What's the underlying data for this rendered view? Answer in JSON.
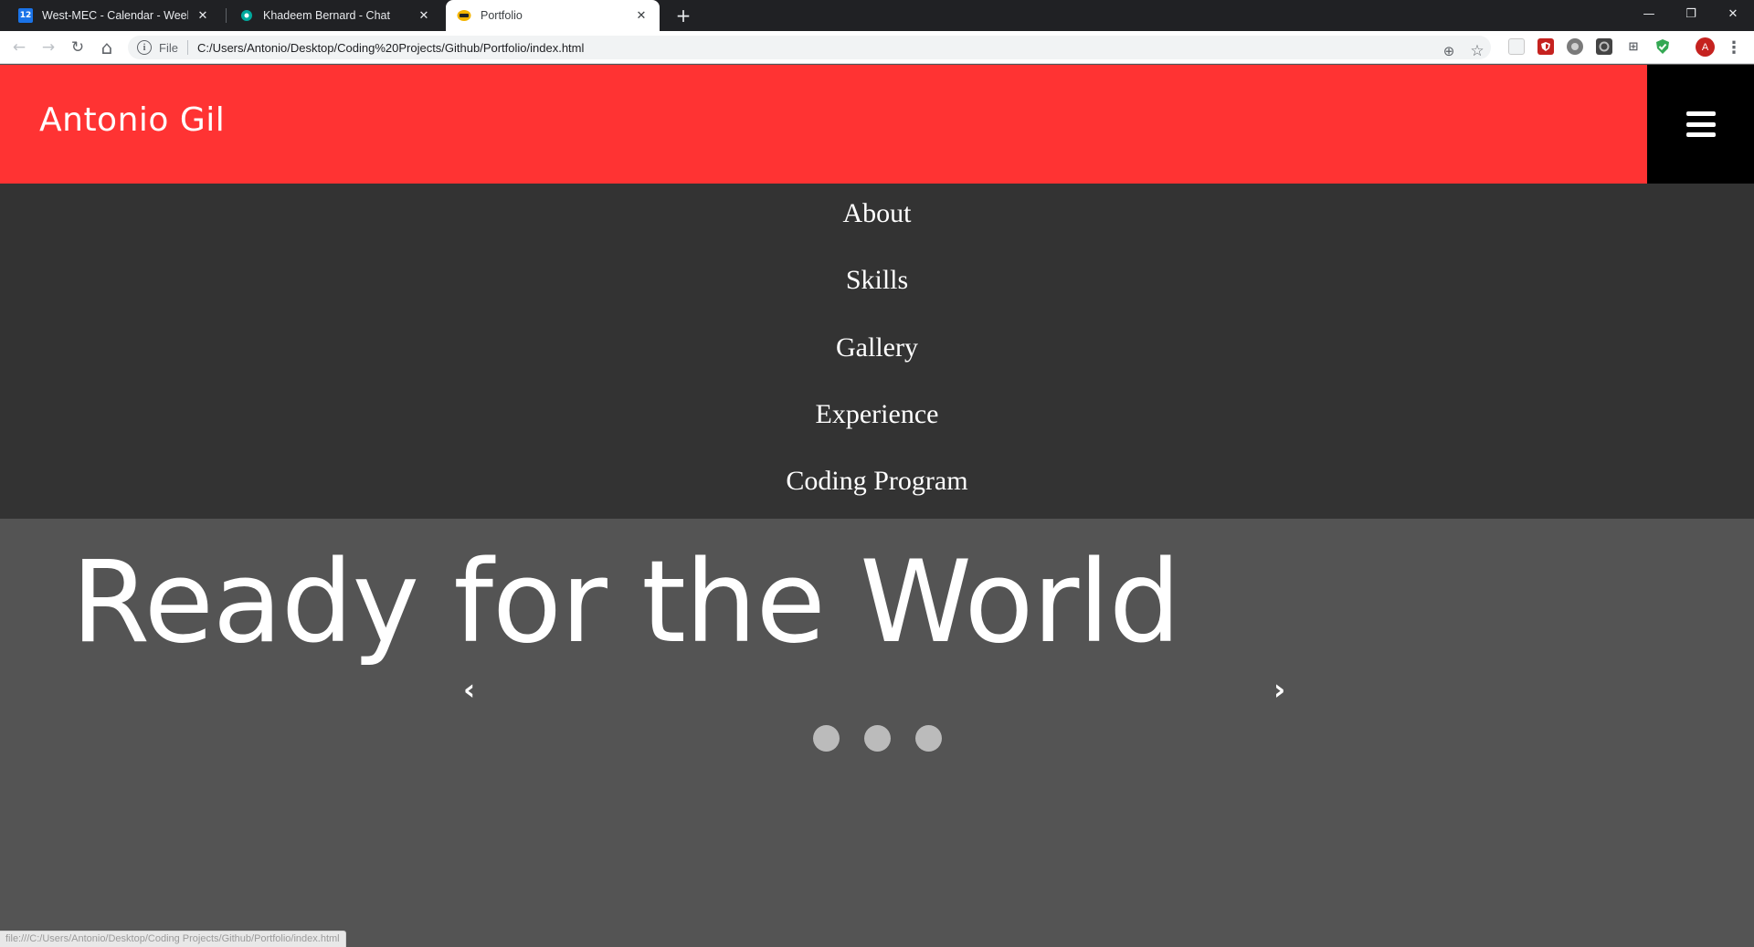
{
  "browser": {
    "tabs": [
      {
        "title": "West-MEC - Calendar - Week of",
        "favicon": "calendar-icon",
        "favicon_text": "12",
        "active": false
      },
      {
        "title": "Khadeem Bernard - Chat",
        "favicon": "chat-icon",
        "favicon_text": "",
        "active": false
      },
      {
        "title": "Portfolio",
        "favicon": "portfolio-icon",
        "favicon_text": "",
        "active": true
      }
    ],
    "new_tab_label": "+",
    "window_controls": {
      "minimize": "—",
      "restore": "❐",
      "close": "✕"
    },
    "nav": {
      "back": "←",
      "forward": "→",
      "reload": "↻",
      "home": "⌂"
    },
    "address_bar": {
      "info_label": "i",
      "scheme_label": "File",
      "url": "C:/Users/Antonio/Desktop/Coding%20Projects/Github/Portfolio/index.html"
    },
    "omnibox_icons": {
      "zoom": "⊕",
      "bookmark": "☆"
    },
    "profile_initial": "A",
    "menu_label": "⋮",
    "status_url": "file:///C:/Users/Antonio/Desktop/Coding Projects/Github/Portfolio/index.html"
  },
  "site": {
    "brand": "Antonio Gil",
    "nav_items": [
      "About",
      "Skills",
      "Gallery",
      "Experience",
      "Coding Program"
    ],
    "hero": {
      "title": "Ready for the World",
      "prev_label": "‹",
      "next_label": "›",
      "slide_count": 3
    }
  },
  "colors": {
    "header_bg": "#ff3333",
    "menu_bg": "#333333",
    "hero_bg": "#545454",
    "hamburger_bg": "#000000",
    "dot": "#bbbbbb"
  }
}
